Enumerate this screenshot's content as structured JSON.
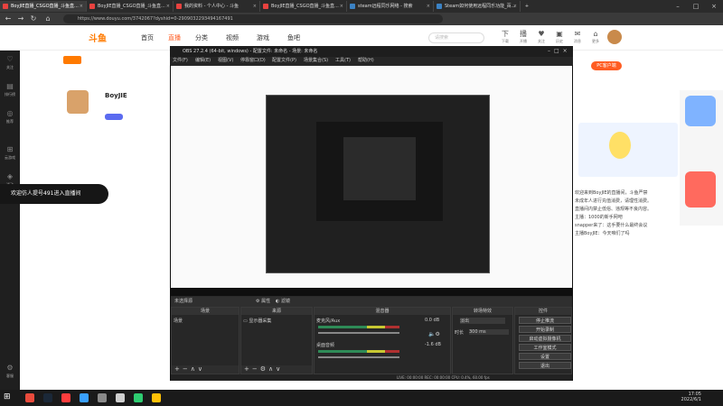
{
  "browser": {
    "tabs": [
      {
        "label": "BoyJIE直播_CSGO直播_斗鱼直..."
      },
      {
        "label": "BoyJIE直播_CSGO直播_斗鱼直..."
      },
      {
        "label": "我的资料 - 个人中心 - 斗鱼"
      },
      {
        "label": "BoyJIE直播_CSGO直播_斗鱼直..."
      },
      {
        "label": "steam远程同乐网络 - 搜索"
      },
      {
        "label": "Steam如何使用远程同乐功能_百..."
      }
    ],
    "url": "https://www.douyu.com/3742067?dyshid=0-2909032293494167491",
    "nav_icons": [
      "back-icon",
      "forward-icon",
      "refresh-icon",
      "home-icon"
    ]
  },
  "site": {
    "logo": "斗鱼",
    "nav": [
      {
        "label": "首页"
      },
      {
        "label": "直播",
        "selected": true
      },
      {
        "label": "分类"
      },
      {
        "label": "视频"
      },
      {
        "label": "游戏"
      },
      {
        "label": "鱼吧"
      }
    ],
    "search_placeholder": "请搜索",
    "header_icons": [
      {
        "icon": "下",
        "label": "下载"
      },
      {
        "icon": "播",
        "label": "开播"
      },
      {
        "icon": "♥",
        "label": "关注"
      },
      {
        "icon": "▣",
        "label": "历史"
      },
      {
        "icon": "✉",
        "label": "消息"
      },
      {
        "icon": "⌂",
        "label": "更多"
      }
    ],
    "rail": [
      {
        "icon": "♡",
        "label": "关注"
      },
      {
        "icon": "▤",
        "label": "排行榜"
      },
      {
        "icon": "◎",
        "label": "推荐"
      },
      {
        "icon": "⊞",
        "label": "云游戏"
      },
      {
        "icon": "◈",
        "label": "活动"
      },
      {
        "icon": "⚙",
        "label": "客服"
      }
    ],
    "streamer_name": "BoyJIE",
    "toast": "欢迎仿人提号491进入直播间",
    "pc_client": "PC客户端"
  },
  "obs": {
    "title": "OBS 27.2.4 (64-bit, windows) - 配置文件: 未命名 - 场景: 未命名",
    "menu": [
      "文件(F)",
      "编辑(E)",
      "视图(V)",
      "停靠窗口(D)",
      "配置文件(P)",
      "场景集合(S)",
      "工具(T)",
      "帮助(H)"
    ],
    "scene_bar": {
      "label": "未选择源",
      "properties": "属性",
      "filters": "滤镜"
    },
    "docks": {
      "scenes": {
        "title": "场景",
        "item": "场景"
      },
      "sources": {
        "title": "来源",
        "item": "显示器采集"
      },
      "mixer": {
        "title": "混音器",
        "ch1": "桌面音频",
        "ch1_db": "-1.6 dB",
        "ch2": "麦克风/Aux",
        "ch2_db": "0.0 dB"
      },
      "transitions": {
        "title": "转场特效",
        "type": "淡出",
        "duration_label": "时长",
        "duration": "300 ms"
      },
      "controls": {
        "title": "控件",
        "buttons": [
          "停止推流",
          "开始录制",
          "启动虚拟摄像机",
          "工作室模式",
          "设置",
          "退出"
        ]
      }
    },
    "status": "LIVE: 00:00:00   REC: 00:00:00   CPU: 0.4%, 60.00 fps"
  },
  "chat": [
    "欢迎来到BoyJIE的直播间，斗鱼严禁",
    "未成年人进行充值消费，请理性消费。",
    "直播间内禁止低俗、违规等不良内容。",
    "主播：1000的新手网吧",
    "snapper来了：这手要什么最终会议",
    "主播BoyJIE：今天咱们了吗"
  ],
  "taskbar": {
    "time": "17:05",
    "date": "2022/6/1"
  }
}
